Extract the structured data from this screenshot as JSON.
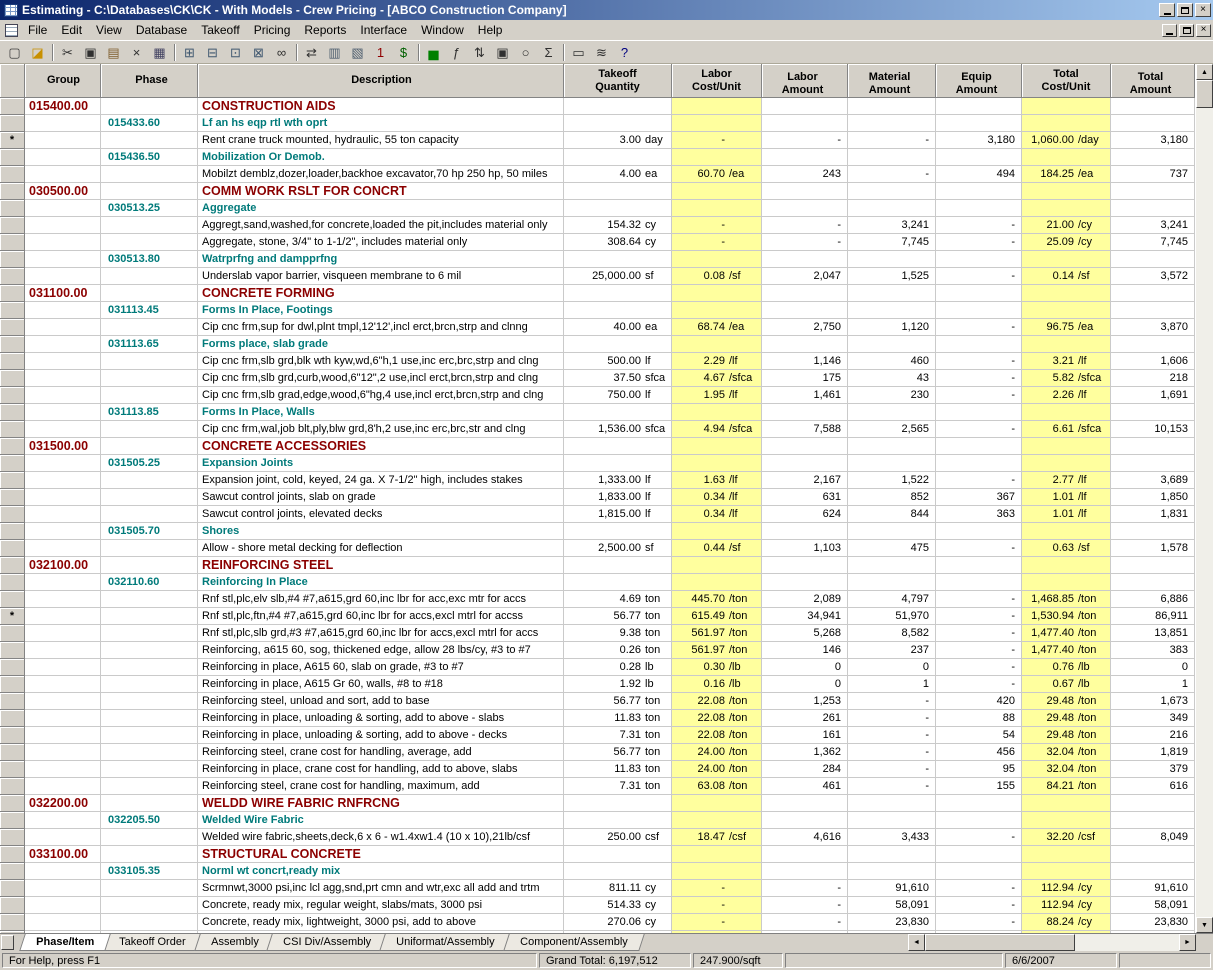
{
  "window": {
    "title": "Estimating - C:\\Databases\\CK\\CK - With Models - Crew Pricing - [ABCO Construction Company]",
    "controls": {
      "close": "×"
    }
  },
  "menu": {
    "items": [
      "File",
      "Edit",
      "View",
      "Database",
      "Takeoff",
      "Pricing",
      "Reports",
      "Interface",
      "Window",
      "Help"
    ]
  },
  "toolbar": {
    "buttons": [
      {
        "name": "new-estimate-button",
        "glyph": "▢",
        "color": "#404040"
      },
      {
        "name": "open-estimate-button",
        "glyph": "◪",
        "color": "#c89000"
      },
      {
        "name": "separator"
      },
      {
        "name": "cut-button",
        "glyph": "✂",
        "color": "#303030"
      },
      {
        "name": "copy-button",
        "glyph": "▣",
        "color": "#303030"
      },
      {
        "name": "paste-button",
        "glyph": "▤",
        "color": "#806030"
      },
      {
        "name": "delete-button",
        "glyph": "×",
        "color": "#303030"
      },
      {
        "name": "print-button",
        "glyph": "▦",
        "color": "#404060"
      },
      {
        "name": "separator"
      },
      {
        "name": "takeoff-button",
        "glyph": "⊞",
        "color": "#405870"
      },
      {
        "name": "quick-takeoff-button",
        "glyph": "⊟",
        "color": "#405870"
      },
      {
        "name": "item-takeoff-button",
        "glyph": "⊡",
        "color": "#405870"
      },
      {
        "name": "review-takeoff-button",
        "glyph": "⊠",
        "color": "#405870"
      },
      {
        "name": "find-button",
        "glyph": "∞",
        "color": "#303030"
      },
      {
        "name": "separator"
      },
      {
        "name": "goto-button",
        "glyph": "⇄",
        "color": "#303030"
      },
      {
        "name": "database-button",
        "glyph": "▥",
        "color": "#506070"
      },
      {
        "name": "crew-pricing-button",
        "glyph": "▧",
        "color": "#506070"
      },
      {
        "name": "single-item-button",
        "glyph": "1",
        "color": "#900000"
      },
      {
        "name": "pricing-button",
        "glyph": "$",
        "color": "#006000"
      },
      {
        "name": "separator"
      },
      {
        "name": "chart-button",
        "glyph": "▅",
        "color": "#008000"
      },
      {
        "name": "formula-button",
        "glyph": "ƒ",
        "color": "#303030"
      },
      {
        "name": "sort-button",
        "glyph": "⇅",
        "color": "#303030"
      },
      {
        "name": "camera-button",
        "glyph": "▣",
        "color": "#303030"
      },
      {
        "name": "zoom-button",
        "glyph": "○",
        "color": "#303030"
      },
      {
        "name": "sum-button",
        "glyph": "Σ",
        "color": "#303030"
      },
      {
        "name": "separator"
      },
      {
        "name": "detail-window-button",
        "glyph": "▭",
        "color": "#303030"
      },
      {
        "name": "sort-order-button",
        "glyph": "≋",
        "color": "#303030"
      },
      {
        "name": "help-button",
        "glyph": "?",
        "color": "#000080"
      }
    ]
  },
  "scrollbars": {
    "up": "▲",
    "down": "▼",
    "left": "◄",
    "right": "►"
  },
  "grid": {
    "columns": [
      {},
      {
        "l1": "Group"
      },
      {
        "l1": "Phase"
      },
      {
        "l1": "Description"
      },
      {
        "l1": "Takeoff",
        "l2": "Quantity"
      },
      {
        "l1": "Labor",
        "l2": "Cost/Unit"
      },
      {
        "l1": "Labor",
        "l2": "Amount"
      },
      {
        "l1": "Material",
        "l2": "Amount"
      },
      {
        "l1": "Equip",
        "l2": "Amount"
      },
      {
        "l1": "Total",
        "l2": "Cost/Unit"
      },
      {
        "l1": "Total",
        "l2": "Amount"
      }
    ],
    "rows": [
      {
        "t": "g",
        "group": "015400.00",
        "desc": "CONSTRUCTION AIDS"
      },
      {
        "t": "p",
        "phase": "015433.60",
        "desc": "Lf an hs eqp rtl wth oprt"
      },
      {
        "t": "i",
        "star": "*",
        "desc": "Rent crane truck mounted, hydraulic, 55 ton capacity",
        "qty": "3.00",
        "qty_u": "day",
        "lcu": "-",
        "la": "-",
        "ma": "-",
        "ea": "3,180",
        "tcu": "1,060.00",
        "tcu_u": "/day",
        "ta": "3,180"
      },
      {
        "t": "p",
        "phase": "015436.50",
        "desc": "Mobilization Or Demob."
      },
      {
        "t": "i",
        "desc": "Mobilzt demblz,dozer,loader,backhoe excavator,70 hp 250 hp, 50 miles",
        "qty": "4.00",
        "qty_u": "ea",
        "lcu": "60.70",
        "lcu_u": "/ea",
        "la": "243",
        "ma": "-",
        "ea": "494",
        "tcu": "184.25",
        "tcu_u": "/ea",
        "ta": "737"
      },
      {
        "t": "g",
        "group": "030500.00",
        "desc": "COMM WORK RSLT FOR CONCRT"
      },
      {
        "t": "p",
        "phase": "030513.25",
        "desc": "Aggregate"
      },
      {
        "t": "i",
        "desc": "Aggregt,sand,washed,for concrete,loaded the pit,includes material only",
        "qty": "154.32",
        "qty_u": "cy",
        "lcu": "-",
        "la": "-",
        "ma": "3,241",
        "ea": "-",
        "tcu": "21.00",
        "tcu_u": "/cy",
        "ta": "3,241"
      },
      {
        "t": "i",
        "desc": "Aggregate, stone, 3/4\" to 1-1/2\", includes material only",
        "qty": "308.64",
        "qty_u": "cy",
        "lcu": "-",
        "la": "-",
        "ma": "7,745",
        "ea": "-",
        "tcu": "25.09",
        "tcu_u": "/cy",
        "ta": "7,745"
      },
      {
        "t": "p",
        "phase": "030513.80",
        "desc": "Watrprfng and dampprfng"
      },
      {
        "t": "i",
        "desc": "Underslab vapor barrier, visqueen membrane to 6 mil",
        "qty": "25,000.00",
        "qty_u": "sf",
        "lcu": "0.08",
        "lcu_u": "/sf",
        "la": "2,047",
        "ma": "1,525",
        "ea": "-",
        "tcu": "0.14",
        "tcu_u": "/sf",
        "ta": "3,572"
      },
      {
        "t": "g",
        "group": "031100.00",
        "desc": "CONCRETE FORMING"
      },
      {
        "t": "p",
        "phase": "031113.45",
        "desc": "Forms In Place, Footings"
      },
      {
        "t": "i",
        "desc": "Cip cnc frm,sup for dwl,plnt tmpl,12'12',incl erct,brcn,strp and clnng",
        "qty": "40.00",
        "qty_u": "ea",
        "lcu": "68.74",
        "lcu_u": "/ea",
        "la": "2,750",
        "ma": "1,120",
        "ea": "-",
        "tcu": "96.75",
        "tcu_u": "/ea",
        "ta": "3,870"
      },
      {
        "t": "p",
        "phase": "031113.65",
        "desc": "Forms place, slab grade"
      },
      {
        "t": "i",
        "desc": "Cip cnc frm,slb grd,blk wth kyw,wd,6\"h,1 use,inc erc,brc,strp and clng",
        "qty": "500.00",
        "qty_u": "lf",
        "lcu": "2.29",
        "lcu_u": "/lf",
        "la": "1,146",
        "ma": "460",
        "ea": "-",
        "tcu": "3.21",
        "tcu_u": "/lf",
        "ta": "1,606"
      },
      {
        "t": "i",
        "desc": "Cip cnc frm,slb grd,curb,wood,6\"12\",2 use,incl erct,brcn,strp and clng",
        "qty": "37.50",
        "qty_u": "sfca",
        "lcu": "4.67",
        "lcu_u": "/sfca",
        "la": "175",
        "ma": "43",
        "ea": "-",
        "tcu": "5.82",
        "tcu_u": "/sfca",
        "ta": "218"
      },
      {
        "t": "i",
        "desc": "Cip cnc frm,slb grad,edge,wood,6\"hg,4 use,incl erct,brcn,strp and clng",
        "qty": "750.00",
        "qty_u": "lf",
        "lcu": "1.95",
        "lcu_u": "/lf",
        "la": "1,461",
        "ma": "230",
        "ea": "-",
        "tcu": "2.26",
        "tcu_u": "/lf",
        "ta": "1,691"
      },
      {
        "t": "p",
        "phase": "031113.85",
        "desc": "Forms In Place, Walls"
      },
      {
        "t": "i",
        "desc": "Cip cnc frm,wal,job blt,ply,blw grd,8'h,2 use,inc erc,brc,str and clng",
        "qty": "1,536.00",
        "qty_u": "sfca",
        "lcu": "4.94",
        "lcu_u": "/sfca",
        "la": "7,588",
        "ma": "2,565",
        "ea": "-",
        "tcu": "6.61",
        "tcu_u": "/sfca",
        "ta": "10,153"
      },
      {
        "t": "g",
        "group": "031500.00",
        "desc": "CONCRETE ACCESSORIES"
      },
      {
        "t": "p",
        "phase": "031505.25",
        "desc": "Expansion Joints"
      },
      {
        "t": "i",
        "desc": "Expansion joint, cold, keyed, 24 ga. X 7-1/2\" high, includes stakes",
        "qty": "1,333.00",
        "qty_u": "lf",
        "lcu": "1.63",
        "lcu_u": "/lf",
        "la": "2,167",
        "ma": "1,522",
        "ea": "-",
        "tcu": "2.77",
        "tcu_u": "/lf",
        "ta": "3,689"
      },
      {
        "t": "i",
        "desc": "Sawcut control joints, slab on grade",
        "qty": "1,833.00",
        "qty_u": "lf",
        "lcu": "0.34",
        "lcu_u": "/lf",
        "la": "631",
        "ma": "852",
        "ea": "367",
        "tcu": "1.01",
        "tcu_u": "/lf",
        "ta": "1,850"
      },
      {
        "t": "i",
        "desc": "Sawcut control joints, elevated decks",
        "qty": "1,815.00",
        "qty_u": "lf",
        "lcu": "0.34",
        "lcu_u": "/lf",
        "la": "624",
        "ma": "844",
        "ea": "363",
        "tcu": "1.01",
        "tcu_u": "/lf",
        "ta": "1,831"
      },
      {
        "t": "p",
        "phase": "031505.70",
        "desc": "Shores"
      },
      {
        "t": "i",
        "desc": "Allow - shore metal decking for deflection",
        "qty": "2,500.00",
        "qty_u": "sf",
        "lcu": "0.44",
        "lcu_u": "/sf",
        "la": "1,103",
        "ma": "475",
        "ea": "-",
        "tcu": "0.63",
        "tcu_u": "/sf",
        "ta": "1,578"
      },
      {
        "t": "g",
        "group": "032100.00",
        "desc": "REINFORCING STEEL"
      },
      {
        "t": "p",
        "phase": "032110.60",
        "desc": "Reinforcing In Place"
      },
      {
        "t": "i",
        "desc": "Rnf stl,plc,elv slb,#4 #7,a615,grd 60,inc lbr for acc,exc mtr for accs",
        "qty": "4.69",
        "qty_u": "ton",
        "lcu": "445.70",
        "lcu_u": "/ton",
        "la": "2,089",
        "ma": "4,797",
        "ea": "-",
        "tcu": "1,468.85",
        "tcu_u": "/ton",
        "ta": "6,886"
      },
      {
        "t": "i",
        "star": "*",
        "desc": "Rnf stl,plc,ftn,#4 #7,a615,grd 60,inc lbr for accs,excl mtrl for accss",
        "qty": "56.77",
        "qty_u": "ton",
        "lcu": "615.49",
        "lcu_u": "/ton",
        "la": "34,941",
        "ma": "51,970",
        "ea": "-",
        "tcu": "1,530.94",
        "tcu_u": "/ton",
        "ta": "86,911"
      },
      {
        "t": "i",
        "desc": "Rnf stl,plc,slb grd,#3 #7,a615,grd 60,inc lbr for accs,excl mtrl for accs",
        "qty": "9.38",
        "qty_u": "ton",
        "lcu": "561.97",
        "lcu_u": "/ton",
        "la": "5,268",
        "ma": "8,582",
        "ea": "-",
        "tcu": "1,477.40",
        "tcu_u": "/ton",
        "ta": "13,851"
      },
      {
        "t": "i",
        "desc": "Reinforcing, a615 60, sog, thickened edge, allow 28 lbs/cy, #3 to #7",
        "qty": "0.26",
        "qty_u": "ton",
        "lcu": "561.97",
        "lcu_u": "/ton",
        "la": "146",
        "ma": "237",
        "ea": "-",
        "tcu": "1,477.40",
        "tcu_u": "/ton",
        "ta": "383"
      },
      {
        "t": "i",
        "desc": "Reinforcing in place, A615 60, slab on grade, #3 to #7",
        "qty": "0.28",
        "qty_u": "lb",
        "lcu": "0.30",
        "lcu_u": "/lb",
        "la": "0",
        "ma": "0",
        "ea": "-",
        "tcu": "0.76",
        "tcu_u": "/lb",
        "ta": "0"
      },
      {
        "t": "i",
        "desc": "Reinforcing in place, A615 Gr 60, walls, #8 to #18",
        "qty": "1.92",
        "qty_u": "lb",
        "lcu": "0.16",
        "lcu_u": "/lb",
        "la": "0",
        "ma": "1",
        "ea": "-",
        "tcu": "0.67",
        "tcu_u": "/lb",
        "ta": "1"
      },
      {
        "t": "i",
        "desc": "Reinforcing steel, unload and sort, add to base",
        "qty": "56.77",
        "qty_u": "ton",
        "lcu": "22.08",
        "lcu_u": "/ton",
        "la": "1,253",
        "ma": "-",
        "ea": "420",
        "tcu": "29.48",
        "tcu_u": "/ton",
        "ta": "1,673"
      },
      {
        "t": "i",
        "desc": "Reinforcing in place, unloading & sorting, add to above - slabs",
        "qty": "11.83",
        "qty_u": "ton",
        "lcu": "22.08",
        "lcu_u": "/ton",
        "la": "261",
        "ma": "-",
        "ea": "88",
        "tcu": "29.48",
        "tcu_u": "/ton",
        "ta": "349"
      },
      {
        "t": "i",
        "desc": "Reinforcing in place, unloading & sorting, add to above - decks",
        "qty": "7.31",
        "qty_u": "ton",
        "lcu": "22.08",
        "lcu_u": "/ton",
        "la": "161",
        "ma": "-",
        "ea": "54",
        "tcu": "29.48",
        "tcu_u": "/ton",
        "ta": "216"
      },
      {
        "t": "i",
        "desc": "Reinforcing steel, crane cost for handling, average, add",
        "qty": "56.77",
        "qty_u": "ton",
        "lcu": "24.00",
        "lcu_u": "/ton",
        "la": "1,362",
        "ma": "-",
        "ea": "456",
        "tcu": "32.04",
        "tcu_u": "/ton",
        "ta": "1,819"
      },
      {
        "t": "i",
        "desc": "Reinforcing in place, crane cost for handling, add to above, slabs",
        "qty": "11.83",
        "qty_u": "ton",
        "lcu": "24.00",
        "lcu_u": "/ton",
        "la": "284",
        "ma": "-",
        "ea": "95",
        "tcu": "32.04",
        "tcu_u": "/ton",
        "ta": "379"
      },
      {
        "t": "i",
        "desc": "Reinforcing steel, crane cost for handling, maximum, add",
        "qty": "7.31",
        "qty_u": "ton",
        "lcu": "63.08",
        "lcu_u": "/ton",
        "la": "461",
        "ma": "-",
        "ea": "155",
        "tcu": "84.21",
        "tcu_u": "/ton",
        "ta": "616"
      },
      {
        "t": "g",
        "group": "032200.00",
        "desc": "WELDD WIRE FABRIC RNFRCNG"
      },
      {
        "t": "p",
        "phase": "032205.50",
        "desc": "Welded Wire Fabric"
      },
      {
        "t": "i",
        "desc": "Welded wire fabric,sheets,deck,6 x 6 - w1.4xw1.4 (10 x 10),21lb/csf",
        "qty": "250.00",
        "qty_u": "csf",
        "lcu": "18.47",
        "lcu_u": "/csf",
        "la": "4,616",
        "ma": "3,433",
        "ea": "-",
        "tcu": "32.20",
        "tcu_u": "/csf",
        "ta": "8,049"
      },
      {
        "t": "g",
        "group": "033100.00",
        "desc": "STRUCTURAL CONCRETE"
      },
      {
        "t": "p",
        "phase": "033105.35",
        "desc": "Norml wt concrt,ready mix"
      },
      {
        "t": "i",
        "desc": "Scrmnwt,3000 psi,inc lcl agg,snd,prt cmn and wtr,exc all add and trtm",
        "qty": "811.11",
        "qty_u": "cy",
        "lcu": "-",
        "la": "-",
        "ma": "91,610",
        "ea": "-",
        "tcu": "112.94",
        "tcu_u": "/cy",
        "ta": "91,610"
      },
      {
        "t": "i",
        "desc": "Concrete, ready mix, regular weight, slabs/mats, 3000 psi",
        "qty": "514.33",
        "qty_u": "cy",
        "lcu": "-",
        "la": "-",
        "ma": "58,091",
        "ea": "-",
        "tcu": "112.94",
        "tcu_u": "/cy",
        "ta": "58,091"
      },
      {
        "t": "i",
        "desc": "Concrete, ready mix, lightweight, 3000 psi, add to above",
        "qty": "270.06",
        "qty_u": "cy",
        "lcu": "-",
        "la": "-",
        "ma": "23,830",
        "ea": "-",
        "tcu": "88.24",
        "tcu_u": "/cy",
        "ta": "23,830"
      },
      {
        "t": "i",
        "desc": ""
      }
    ]
  },
  "tabs": {
    "active": "Phase/Item",
    "items": [
      "Phase/Item",
      "Takeoff Order",
      "Assembly",
      "CSI Div/Assembly",
      "Uniformat/Assembly",
      "Component/Assembly"
    ]
  },
  "status": {
    "help": "For Help, press F1",
    "grand_total": "Grand Total: 6,197,512",
    "per_sqft": "247.900/sqft",
    "date": "6/6/2007"
  }
}
